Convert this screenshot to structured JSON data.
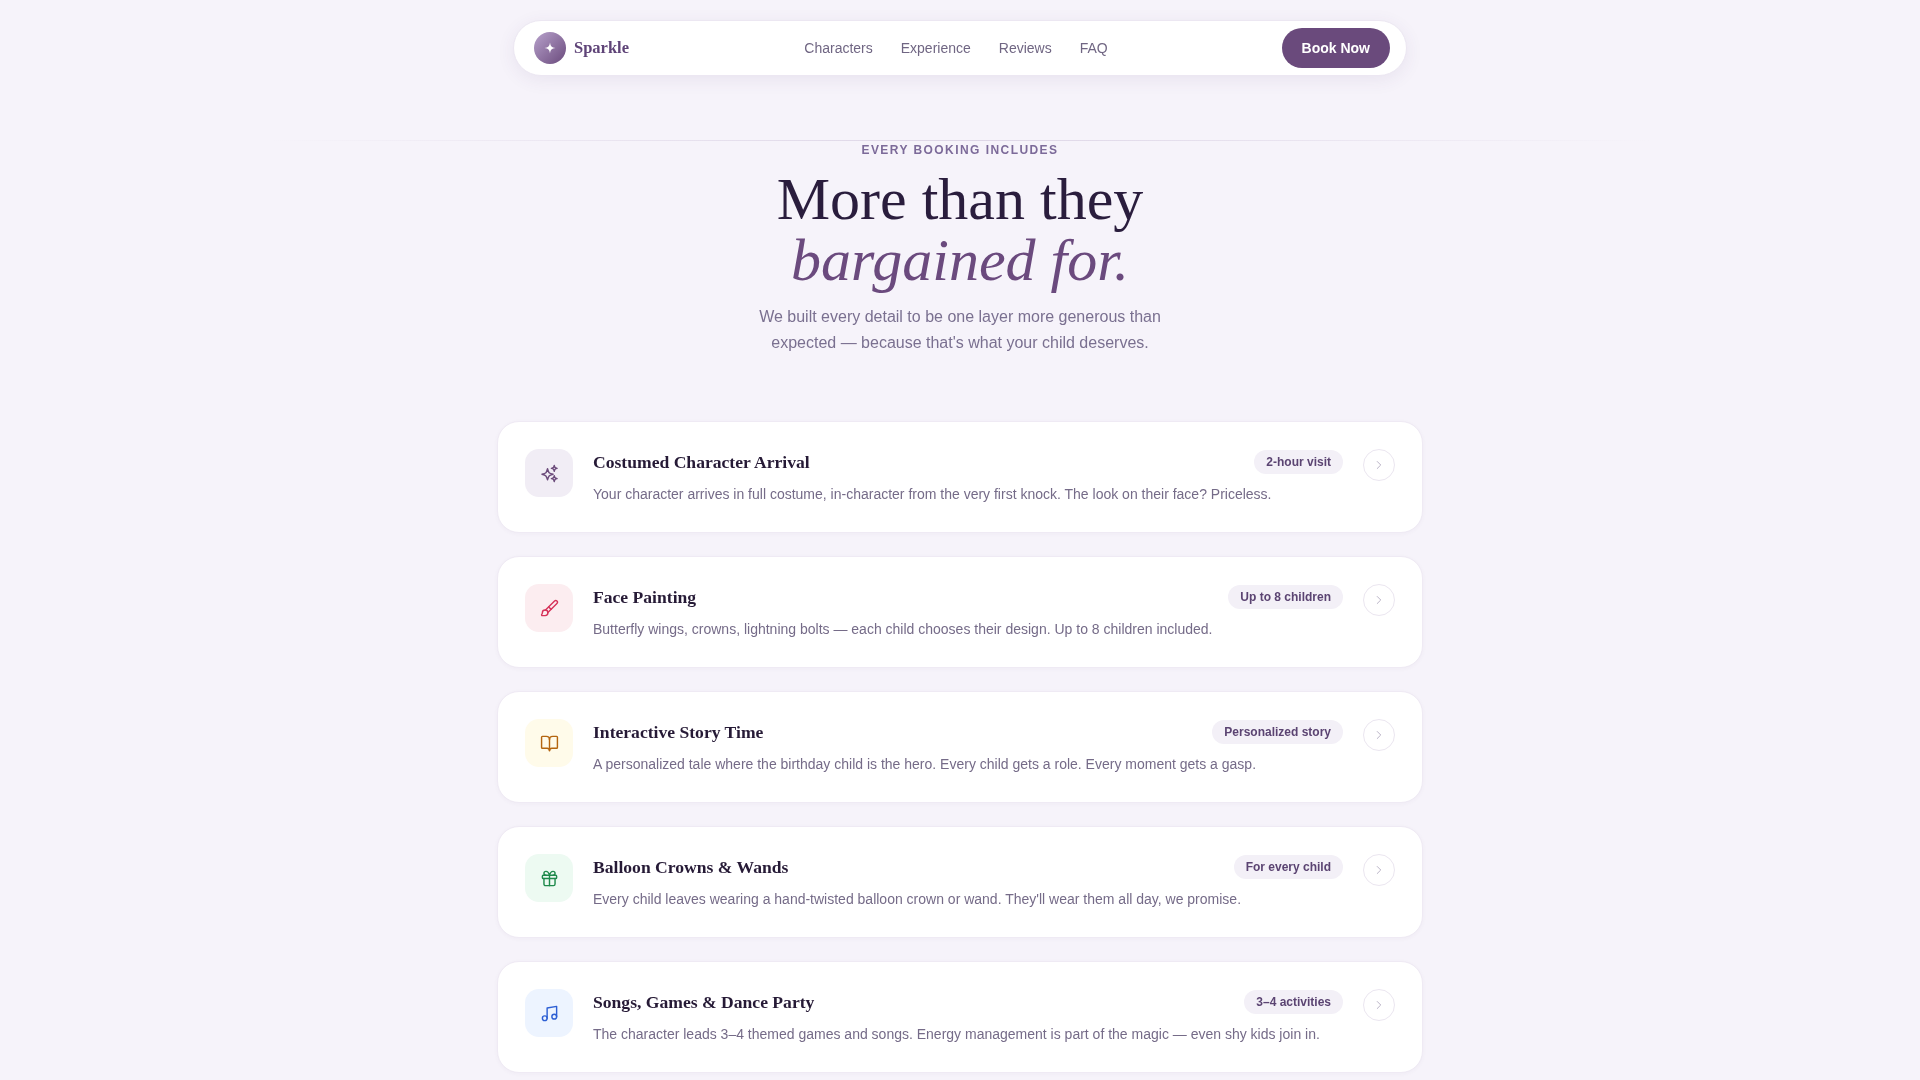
{
  "nav": {
    "brand": "Sparkle",
    "links": [
      "Characters",
      "Experience",
      "Reviews",
      "FAQ"
    ],
    "cta": "Book Now"
  },
  "intro": {
    "eyebrow": "EVERY BOOKING INCLUDES",
    "heading": "More than they *bargained for.*",
    "subtitle": "We built every detail to be one layer more generous than expected — because that's what your child deserves."
  },
  "features": [
    {
      "title": "Costumed Character Arrival",
      "badge": "2-hour visit",
      "description": "Your character arrives in full costume, in-character from the very first knock. The look on their face? Priceless."
    },
    {
      "title": "Face Painting",
      "badge": "Up to 8 children",
      "description": "Butterfly wings, crowns, lightning bolts — each child chooses their design. Up to 8 children included."
    },
    {
      "title": "Interactive Story Time",
      "badge": "Personalized story",
      "description": "A personalized tale where the birthday child is the hero. Every child gets a role. Every moment gets a gasp."
    },
    {
      "title": "Balloon Crowns & Wands",
      "badge": "For every child",
      "description": "Every child leaves wearing a hand-twisted balloon crown or wand. They'll wear them all day, we promise."
    },
    {
      "title": "Songs, Games & Dance Party",
      "badge": "3–4 activities",
      "description": "The character leads 3–4 themed games and songs. Energy management is part of the magic — even shy kids join in."
    }
  ]
}
